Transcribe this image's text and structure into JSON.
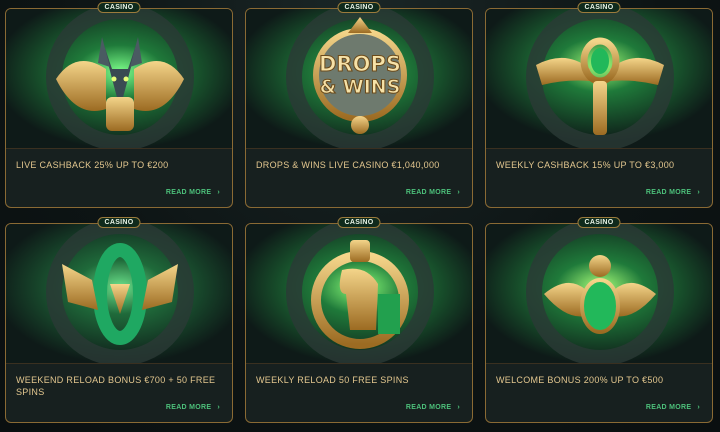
{
  "cards": [
    {
      "badge": "CASINO",
      "title": "LIVE CASHBACK 25% UP TO €200",
      "cta": "READ MORE",
      "art": "jackal-icon"
    },
    {
      "badge": "CASINO",
      "title": "DROPS & WINS LIVE CASINO €1,040,000",
      "cta": "READ MORE",
      "art": "drops-wins-logo",
      "logo_line1": "DROPS",
      "logo_line2": "& WINS"
    },
    {
      "badge": "CASINO",
      "title": "WEEKLY CASHBACK 15% UP TO €3,000",
      "cta": "READ MORE",
      "art": "ankh-icon"
    },
    {
      "badge": "CASINO",
      "title": "WEEKEND RELOAD BONUS €700 + 50 FREE SPINS",
      "cta": "READ MORE",
      "art": "serpent-icon"
    },
    {
      "badge": "CASINO",
      "title": "WEEKLY RELOAD 50 FREE SPINS",
      "cta": "READ MORE",
      "art": "horus-icon"
    },
    {
      "badge": "CASINO",
      "title": "WELCOME BONUS 200% UP TO €500",
      "cta": "READ MORE",
      "art": "scarab-icon"
    }
  ],
  "colors": {
    "accent": "#4cc07a",
    "gold": "#e3c78f",
    "border": "#8a6a34",
    "emerald": "#22b85a"
  }
}
